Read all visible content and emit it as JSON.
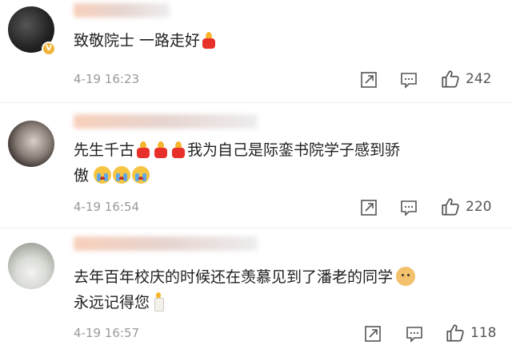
{
  "comments": [
    {
      "text_line1": "致敬院士 一路走好",
      "time": "4-19 16:23",
      "likes": "242",
      "verified_badge": "V"
    },
    {
      "text_line1": "先生千古",
      "text_line1_tail": "我为自己是际銮书院学子感到骄",
      "text_line2": "傲",
      "time": "4-19 16:54",
      "likes": "220"
    },
    {
      "text_line1": "去年百年校庆的时候还在羡慕见到了潘老的同学",
      "text_line2": "永远记得您",
      "time": "4-19 16:57",
      "likes": "118"
    }
  ],
  "icons": [
    "share-icon",
    "reply-icon",
    "like-icon",
    "candle-emoji",
    "crying-emoji",
    "dog-emoji"
  ],
  "colors": {
    "meta": "#9a9a9a",
    "divider": "#ececec",
    "badge": "#f0b43b",
    "candle": "#e8302b"
  }
}
